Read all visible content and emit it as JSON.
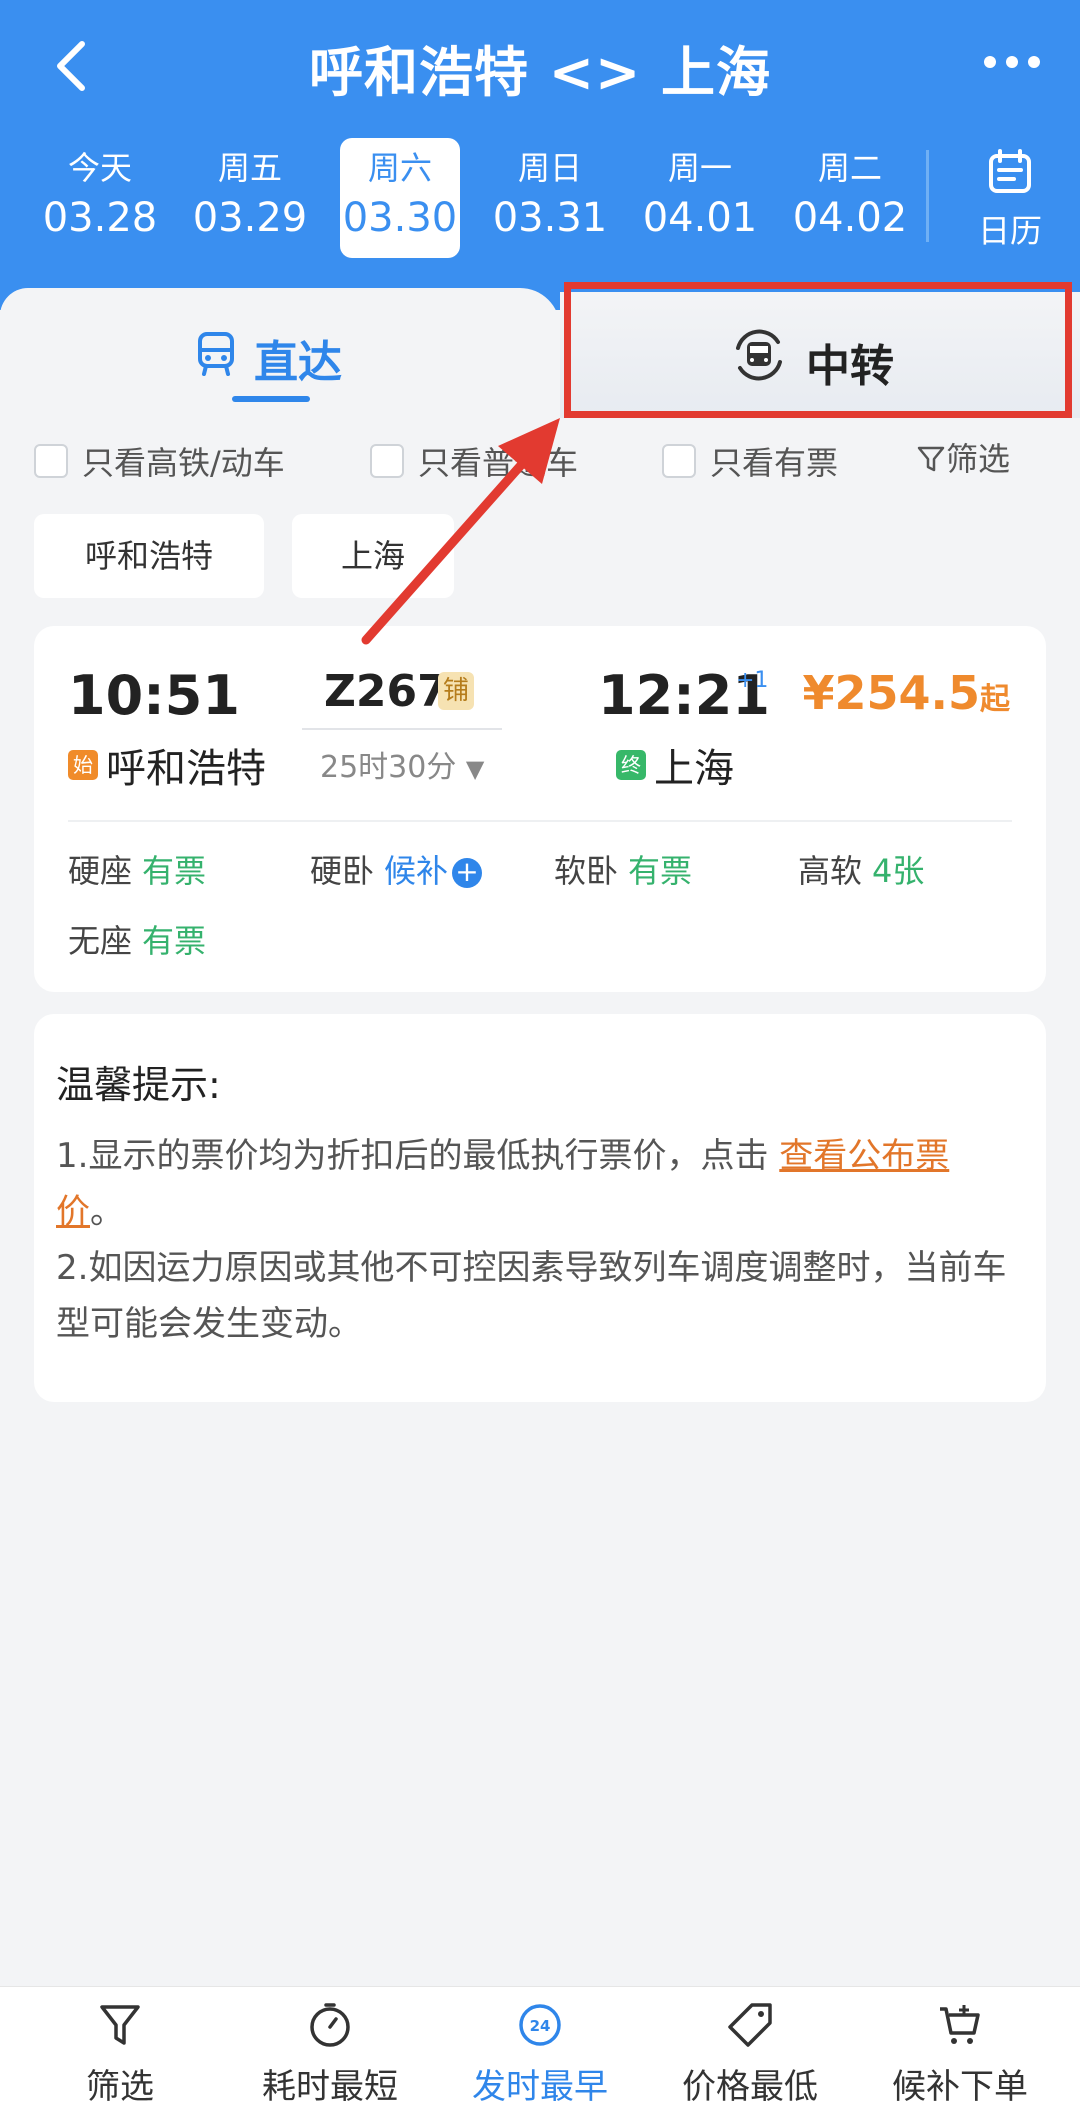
{
  "header": {
    "title": "呼和浩特 <> 上海",
    "colors": {
      "primary": "#3a8ff0"
    }
  },
  "dates": [
    {
      "weekday": "今天",
      "date": "03.28"
    },
    {
      "weekday": "周五",
      "date": "03.29"
    },
    {
      "weekday": "周六",
      "date": "03.30",
      "selected": true
    },
    {
      "weekday": "周日",
      "date": "03.31"
    },
    {
      "weekday": "周一",
      "date": "04.01"
    },
    {
      "weekday": "周二",
      "date": "04.02"
    }
  ],
  "calendar": {
    "label": "日历",
    "icon": "calendar-icon"
  },
  "tabs": {
    "direct": "直达",
    "transfer": "中转",
    "active": "direct"
  },
  "filters": {
    "high_speed": "只看高铁/动车",
    "normal": "只看普通车",
    "available": "只看有票",
    "filter": "筛选"
  },
  "stations": {
    "from": "呼和浩特",
    "to": "上海"
  },
  "train": {
    "dep_time": "10:51",
    "start_badge": "始",
    "dep_station": "呼和浩特",
    "number": "Z267",
    "sleeper_badge": "铺",
    "duration": "25时30分",
    "arr_time": "12:21",
    "day_offset": "+1",
    "end_badge": "终",
    "arr_station": "上海",
    "price": "¥254.5",
    "price_suffix": "起",
    "seats": [
      {
        "name": "硬座",
        "status": "有票"
      },
      {
        "name": "硬卧",
        "status": "候补"
      },
      {
        "name": "软卧",
        "status": "有票"
      },
      {
        "name": "高软",
        "status": "4张"
      },
      {
        "name": "无座",
        "status": "有票"
      }
    ]
  },
  "tips": {
    "title": "温馨提示:",
    "item1_prefix": "1.显示的票价均为折扣后的最低执行票价，点击",
    "item1_link": "查看公布票",
    "item1_link2": "价",
    "item1_suffix": "。",
    "item2": "2.如因运力原因或其他不可控因素导致列车调度调整时，当前车",
    "item2_cont": "型可能会发生变动。"
  },
  "bottom_nav": [
    {
      "label": "筛选",
      "icon": "filter-icon"
    },
    {
      "label": "耗时最短",
      "icon": "timer-icon"
    },
    {
      "label": "发时最早",
      "icon": "clock-24-icon",
      "active": true
    },
    {
      "label": "价格最低",
      "icon": "price-tag-icon"
    },
    {
      "label": "候补下单",
      "icon": "cart-plus-icon"
    }
  ]
}
